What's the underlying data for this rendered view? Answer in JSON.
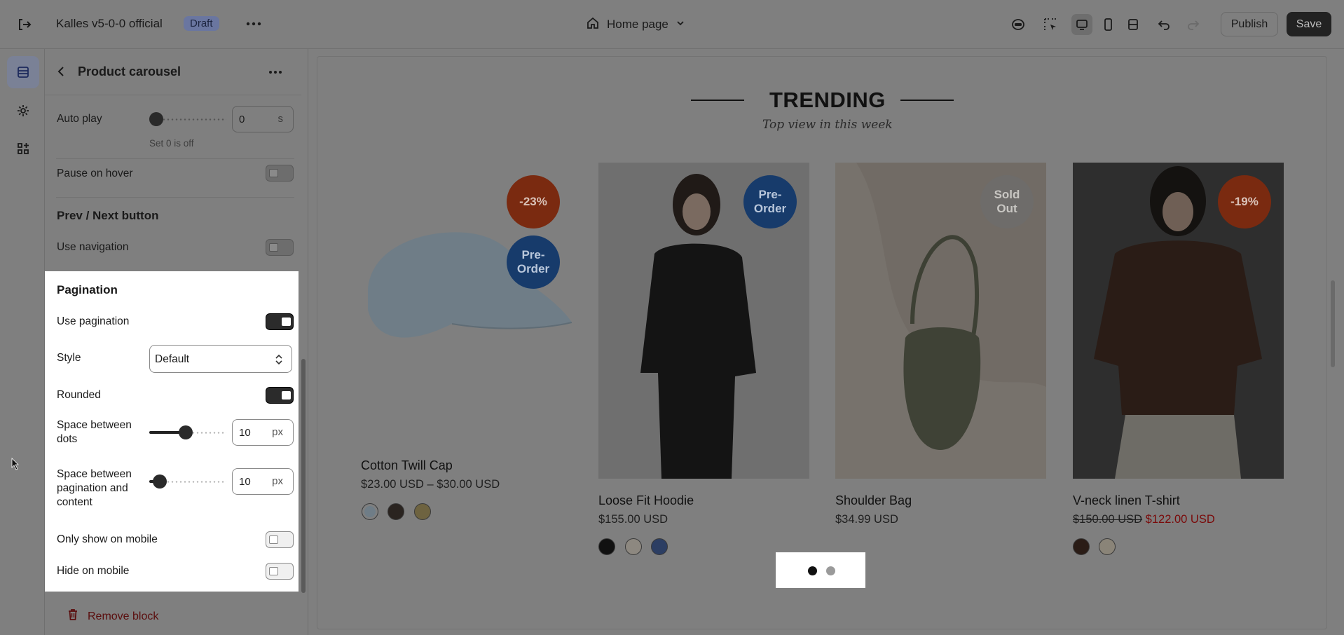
{
  "topbar": {
    "store_name": "Kalles v5-0-0 official",
    "status_badge": "Draft",
    "page_selector": "Home page",
    "publish_label": "Publish",
    "save_label": "Save"
  },
  "panel": {
    "title": "Product carousel",
    "autoplay": {
      "label": "Auto play",
      "value": "0",
      "unit": "s",
      "hint": "Set 0 is off",
      "slider_fraction": 0
    },
    "pause_on_hover": {
      "label": "Pause on hover",
      "on": false
    },
    "prev_next": {
      "section_title": "Prev / Next button",
      "use_navigation_label": "Use navigation",
      "use_navigation_on": false
    },
    "pagination": {
      "section_title": "Pagination",
      "use_pagination_label": "Use pagination",
      "use_pagination_on": true,
      "style_label": "Style",
      "style_value": "Default",
      "rounded_label": "Rounded",
      "rounded_on": true,
      "space_dots_label_1": "Space between",
      "space_dots_label_2": "dots",
      "space_dots_value": "10",
      "space_dots_unit": "px",
      "space_content_label_1": "Space between",
      "space_content_label_2": "pagination and",
      "space_content_label_3": "content",
      "space_content_value": "10",
      "space_content_unit": "px",
      "only_mobile_label": "Only show on mobile",
      "only_mobile_on": false,
      "hide_mobile_label": "Hide on mobile",
      "hide_mobile_on": false
    },
    "remove_block_label": "Remove block"
  },
  "preview": {
    "heading": "TRENDING",
    "subheading": "Top view in this week",
    "products": [
      {
        "name": "Cotton Twill Cap",
        "price": "$23.00 USD – $30.00 USD",
        "badges": [
          "-23%",
          "Pre-\nOrder"
        ]
      },
      {
        "name": "Loose Fit Hoodie",
        "price": "$155.00 USD",
        "badges": [
          "Pre-\nOrder"
        ]
      },
      {
        "name": "Shoulder Bag",
        "price": "$34.99 USD",
        "badges": [
          "Sold\nOut"
        ]
      },
      {
        "name": "V-neck linen T-shirt",
        "price_old": "$150.00 USD",
        "price_sale": "$122.00 USD",
        "badges": [
          "-19%"
        ]
      }
    ],
    "pagination_active_index": 0,
    "pagination_count": 2
  },
  "colors": {
    "accent_dark": "#1e1e1e",
    "sale_badge": "#7a2a10",
    "preorder_badge": "#173b6b",
    "soldout_badge": "#6e6c6a",
    "remove_text": "#5a0d0d"
  }
}
